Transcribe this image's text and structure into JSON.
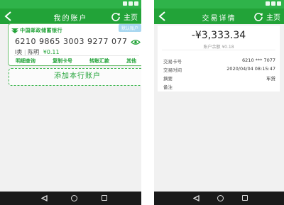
{
  "left_screen": {
    "header": {
      "title": "我的账户",
      "home_label": "主页"
    },
    "card": {
      "bank_name": "中国邮政储蓄银行",
      "badge": "默认账户",
      "card_number": "6210 9865 3003 9277 077",
      "account_type": "I类",
      "holder": "陈明",
      "balance": "¥0.11",
      "actions": [
        "明细查询",
        "复制卡号",
        "转账汇款",
        "其他"
      ]
    },
    "add_account_label": "添加本行账户"
  },
  "right_screen": {
    "header": {
      "title": "交易详情",
      "home_label": "主页"
    },
    "amount": "-¥3,333.34",
    "balance_line": "账户余额 ¥0.18",
    "rows": [
      {
        "label": "交易卡号",
        "value": "6210 *** 7077"
      },
      {
        "label": "交易时间",
        "value": "2020/04/04 08:15:47"
      },
      {
        "label": "摘要",
        "value": "车贷"
      },
      {
        "label": "备注",
        "value": ""
      }
    ]
  },
  "colors": {
    "header_green": "#22a338",
    "status_green": "#2fb34a",
    "accent_green": "#22a338",
    "nav_black": "#1a1a1a"
  },
  "icons": [
    "back-arrow-icon",
    "refresh-icon",
    "bank-logo-icon",
    "eye-icon",
    "chevron-right-icon",
    "nav-back-icon",
    "nav-home-icon",
    "nav-recent-icon"
  ]
}
